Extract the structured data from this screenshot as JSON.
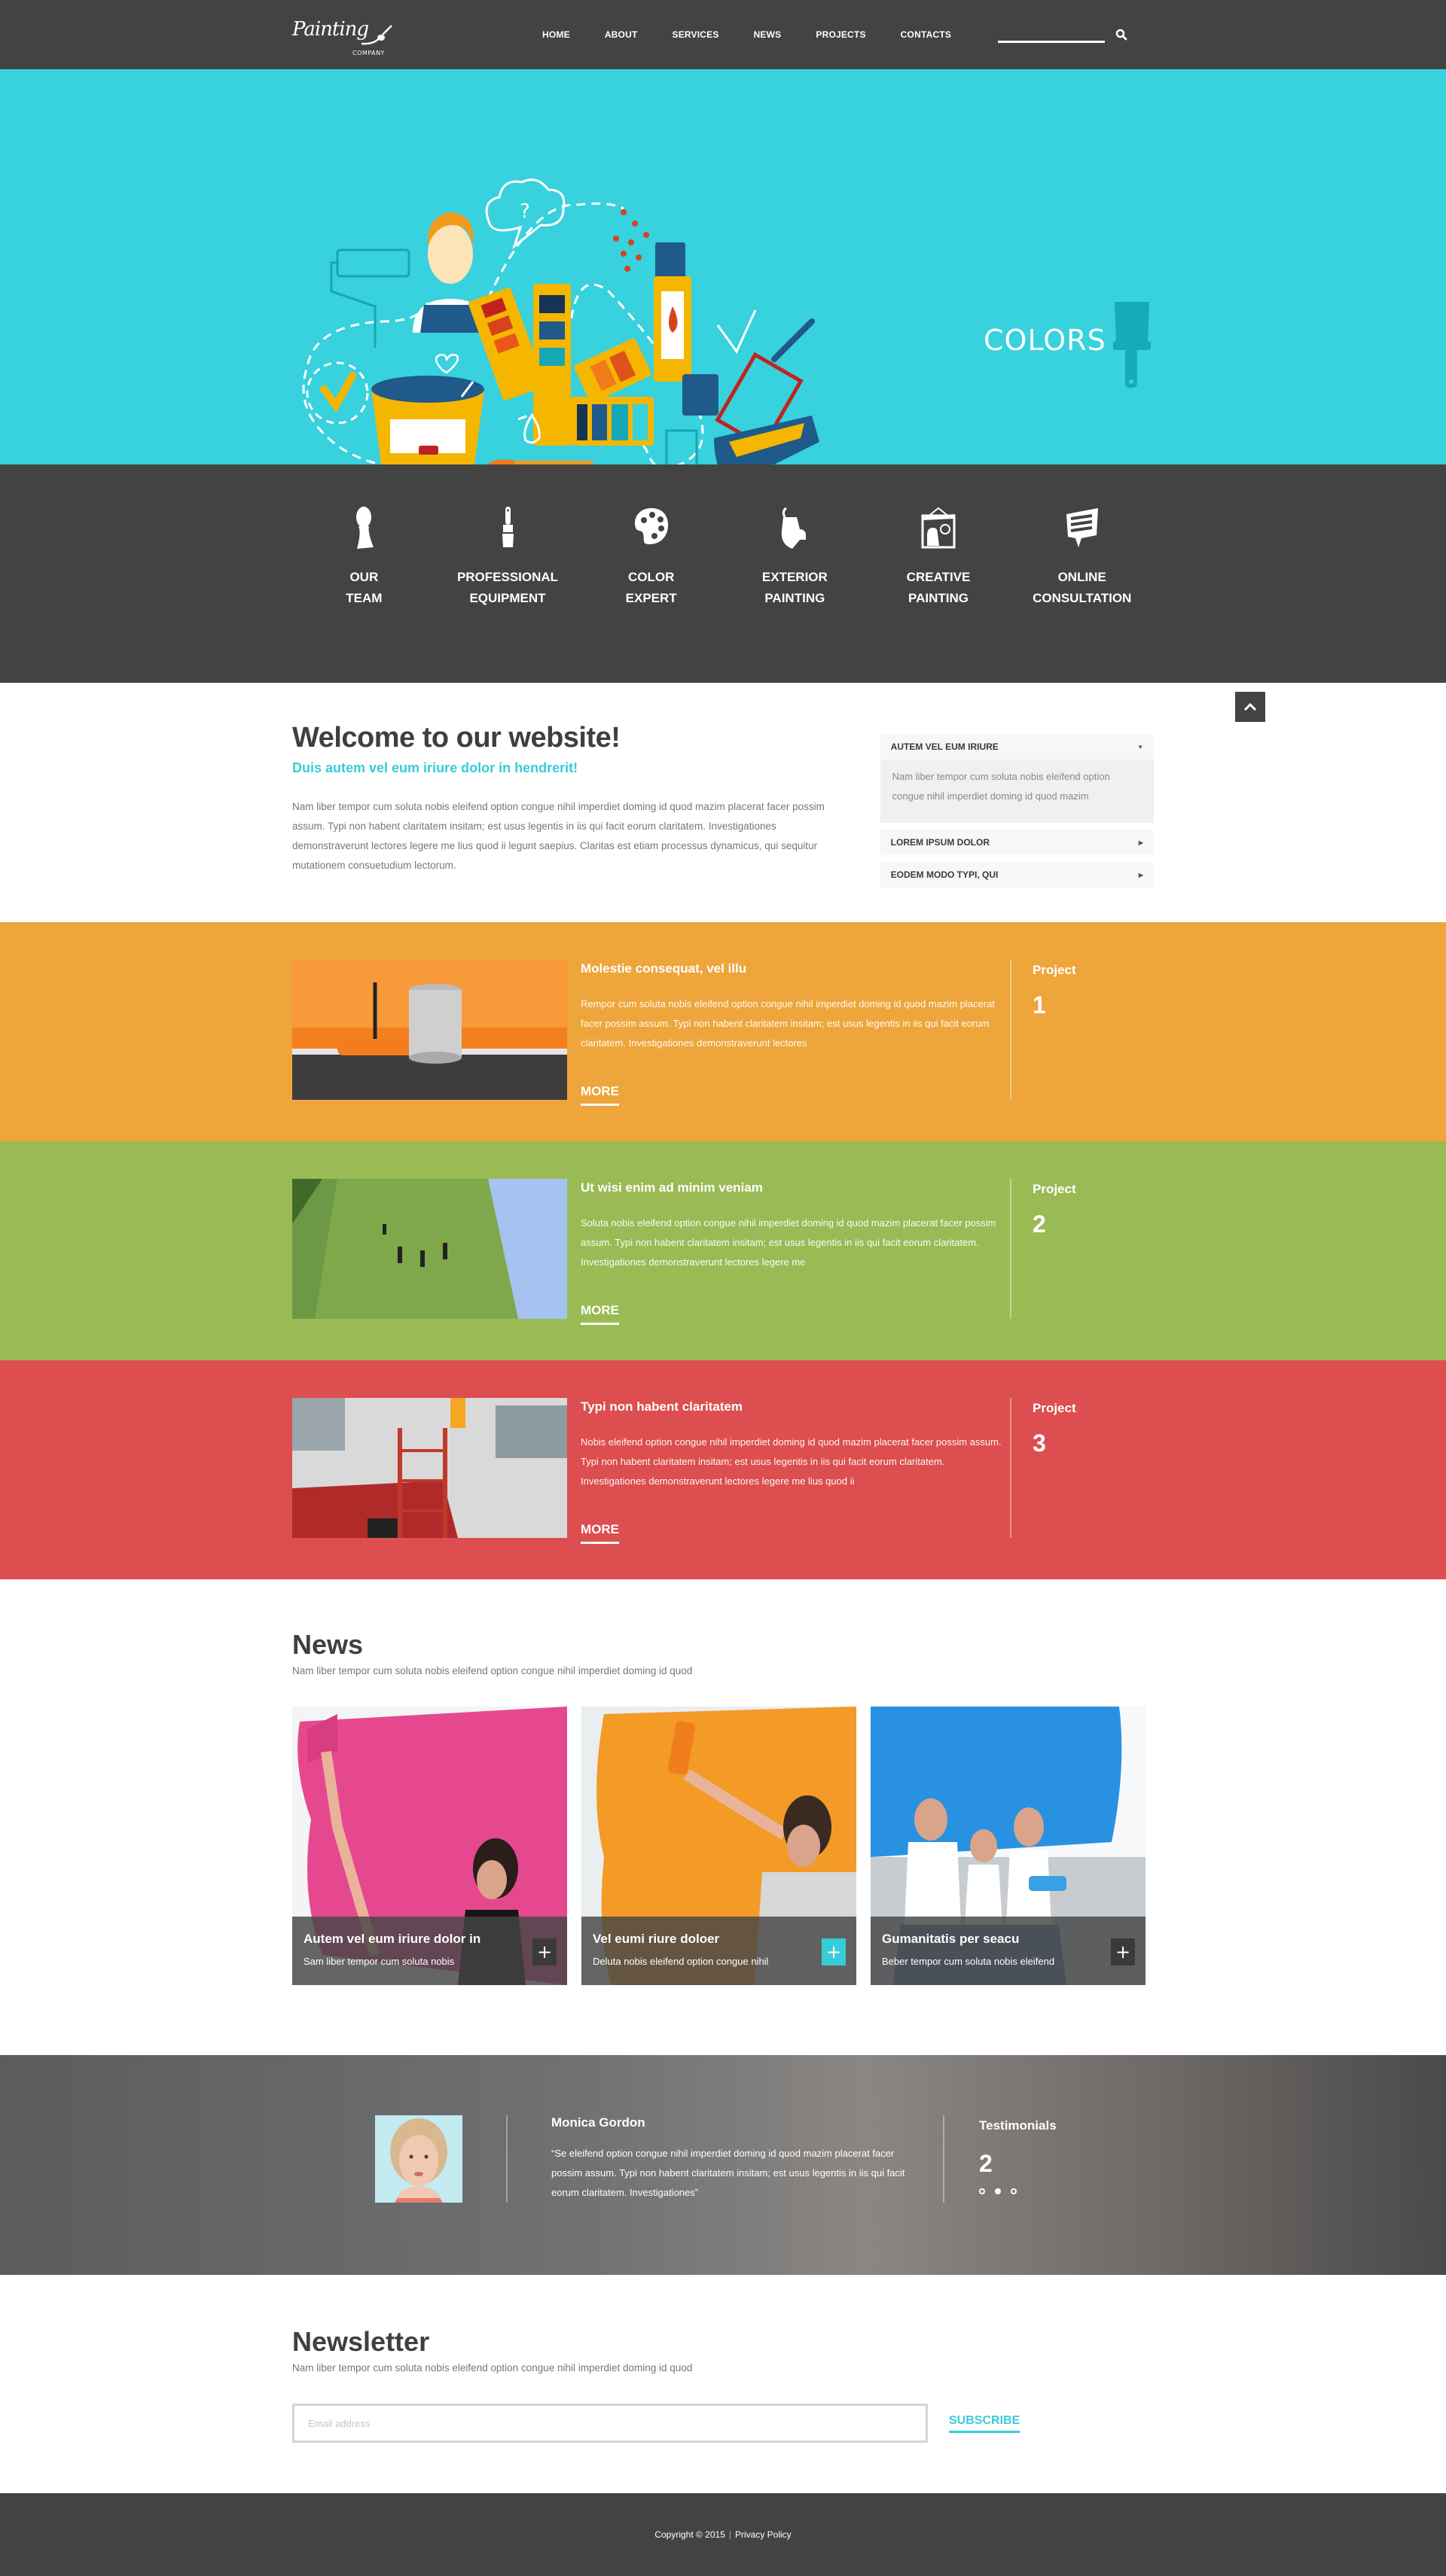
{
  "header": {
    "logo_text": "Painting",
    "logo_sub": "COMPANY",
    "nav": [
      "HOME",
      "ABOUT",
      "SERVICES",
      "NEWS",
      "PROJECTS",
      "CONTACTS"
    ],
    "search_value": ""
  },
  "hero": {
    "caption": "COLORS",
    "slides_total": 3,
    "active_slide": 2,
    "bg_color": "#38d1de"
  },
  "services": [
    {
      "icon": "person-icon",
      "line1": "OUR",
      "line2": "TEAM"
    },
    {
      "icon": "paintbrush-icon",
      "line1": "PROFESSIONAL",
      "line2": "EQUIPMENT"
    },
    {
      "icon": "palette-icon",
      "line1": "COLOR",
      "line2": "EXPERT"
    },
    {
      "icon": "paint-bucket-icon",
      "line1": "EXTERIOR",
      "line2": "PAINTING"
    },
    {
      "icon": "picture-frame-icon",
      "line1": "CREATIVE",
      "line2": "PAINTING"
    },
    {
      "icon": "chat-bubble-icon",
      "line1": "ONLINE",
      "line2": "CONSULTATION"
    }
  ],
  "welcome": {
    "title": "Welcome to our website!",
    "subtitle": "Duis autem vel eum iriure dolor in hendrerit!",
    "body": "Nam liber tempor cum soluta nobis eleifend option congue nihil imperdiet doming id quod mazim placerat facer possim assum. Typi non habent claritatem insitam; est usus legentis in iis qui facit eorum claritatem. Investigationes demonstraverunt lectores legere me lius quod ii legunt saepius. Claritas est etiam processus dynamicus, qui sequitur mutationem consuetudium lectorum.",
    "accordion": [
      {
        "title": "AUTEM VEL EUM IRIURE",
        "expanded": true,
        "body": "Nam liber tempor cum soluta nobis eleifend option congue nihil imperdiet doming id quod mazim"
      },
      {
        "title": "LOREM IPSUM DOLOR",
        "expanded": false
      },
      {
        "title": "EODEM MODO TYPI, QUI",
        "expanded": false
      }
    ]
  },
  "projects": [
    {
      "color": "#eea53b",
      "title": "Molestie consequat, vel illu",
      "body": "Rempor cum soluta nobis eleifend option congue nihil imperdiet doming id quod mazim placerat facer possim assum. Typi non habent claritatem insitam; est usus legentis in iis qui facit eorum claritatem. Investigationes demonstraverunt lectores",
      "more": "MORE",
      "label": "Project",
      "number": "1"
    },
    {
      "color": "#9aba55",
      "title": "Ut wisi enim ad minim veniam",
      "body": "Soluta nobis eleifend option congue nihil imperdiet doming id quod mazim placerat facer possim assum. Typi non habent claritatem insitam; est usus legentis in iis qui facit eorum claritatem. Investigationes demonstraverunt lectores legere me",
      "more": "MORE",
      "label": "Project",
      "number": "2"
    },
    {
      "color": "#dc4e4f",
      "title": "Typi non habent claritatem",
      "body": "Nobis eleifend option congue nihil imperdiet doming id quod mazim placerat facer possim assum. Typi non habent claritatem insitam; est usus legentis in iis qui facit eorum claritatem. Investigationes demonstraverunt lectores legere me lius quod ii",
      "more": "MORE",
      "label": "Project",
      "number": "3"
    }
  ],
  "news": {
    "title": "News",
    "subtitle": "Nam liber tempor cum soluta nobis eleifend option congue nihil imperdiet doming id quod",
    "cards": [
      {
        "title": "Autem vel eum iriure dolor in",
        "text": "Sam liber tempor cum soluta nobis",
        "plus": "+",
        "active": false
      },
      {
        "title": "Vel eumi riure doloer",
        "text": "Deluta nobis eleifend option congue nihil",
        "plus": "+",
        "active": true
      },
      {
        "title": "Gumanitatis per seacu",
        "text": "Beber tempor cum soluta nobis eleifend",
        "plus": "+",
        "active": false
      }
    ]
  },
  "testimonial": {
    "name": "Monica Gordon",
    "quote": "“Se eleifend option congue nihil imperdiet doming id quod mazim placerat facer possim assum. Typi non habent claritatem insitam; est usus legentis in iis qui facit eorum claritatem. Investigationes”",
    "label": "Testimonials",
    "number": "2",
    "slides_total": 3,
    "active_slide": 2
  },
  "newsletter": {
    "title": "Newsletter",
    "subtitle": "Nam liber tempor cum soluta nobis eleifend option congue nihil imperdiet doming id quod",
    "placeholder": "Email address",
    "button": "SUBSCRIBE"
  },
  "footer": {
    "copyright": "Copyright © 2015",
    "separator": "|",
    "privacy": "Privacy Policy"
  },
  "accent_color": "#38ccd8"
}
